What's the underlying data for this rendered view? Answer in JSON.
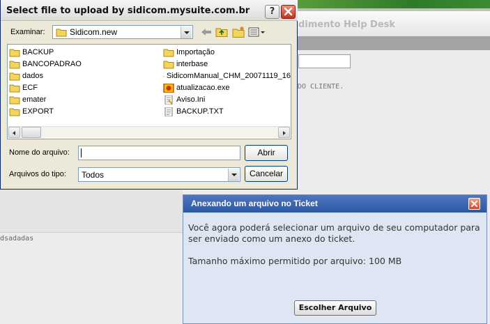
{
  "background": {
    "header_text": "dimento Help Desk",
    "right_text": "DO CLIENTE.",
    "left_text": "dsadadas"
  },
  "file_dialog": {
    "title": "Select file to upload by sidicom.mysuite.com.br",
    "look_in_label": "Examinar:",
    "current_folder": "Sidicom.new",
    "files": [
      {
        "name": "BACKUP",
        "type": "folder"
      },
      {
        "name": "BANCOPADRAO",
        "type": "folder"
      },
      {
        "name": "dados",
        "type": "folder"
      },
      {
        "name": "ECF",
        "type": "folder"
      },
      {
        "name": "emater",
        "type": "folder"
      },
      {
        "name": "EXPORT",
        "type": "folder"
      },
      {
        "name": "Importação",
        "type": "folder"
      },
      {
        "name": "interbase",
        "type": "folder"
      },
      {
        "name": "SidicomManual_CHM_20071119_16",
        "type": "folder"
      },
      {
        "name": "atualizacao.exe",
        "type": "exe"
      },
      {
        "name": "Aviso.Ini",
        "type": "ini"
      },
      {
        "name": "BACKUP.TXT",
        "type": "txt"
      }
    ],
    "filename_label": "Nome do arquivo:",
    "filename_value": "",
    "filetype_label": "Arquivos do tipo:",
    "filetype_value": "Todos",
    "open_label": "Abrir",
    "cancel_label": "Cancelar"
  },
  "ticket_dialog": {
    "title": "Anexando um arquivo no Ticket",
    "line1": "Você agora poderá selecionar um arquivo de seu computador para",
    "line2": "ser enviado como um anexo do ticket.",
    "line3": "Tamanho máximo permitido por arquivo: 100 MB",
    "button_label": "Escolher Arquivo"
  },
  "colors": {
    "ticket_title_bg": "#2e58a4",
    "ticket_body_bg": "#dfe6f3",
    "dialog_bg": "#ece9d8",
    "close_red": "#c4321a",
    "folder_yellow": "#f5d45c"
  }
}
